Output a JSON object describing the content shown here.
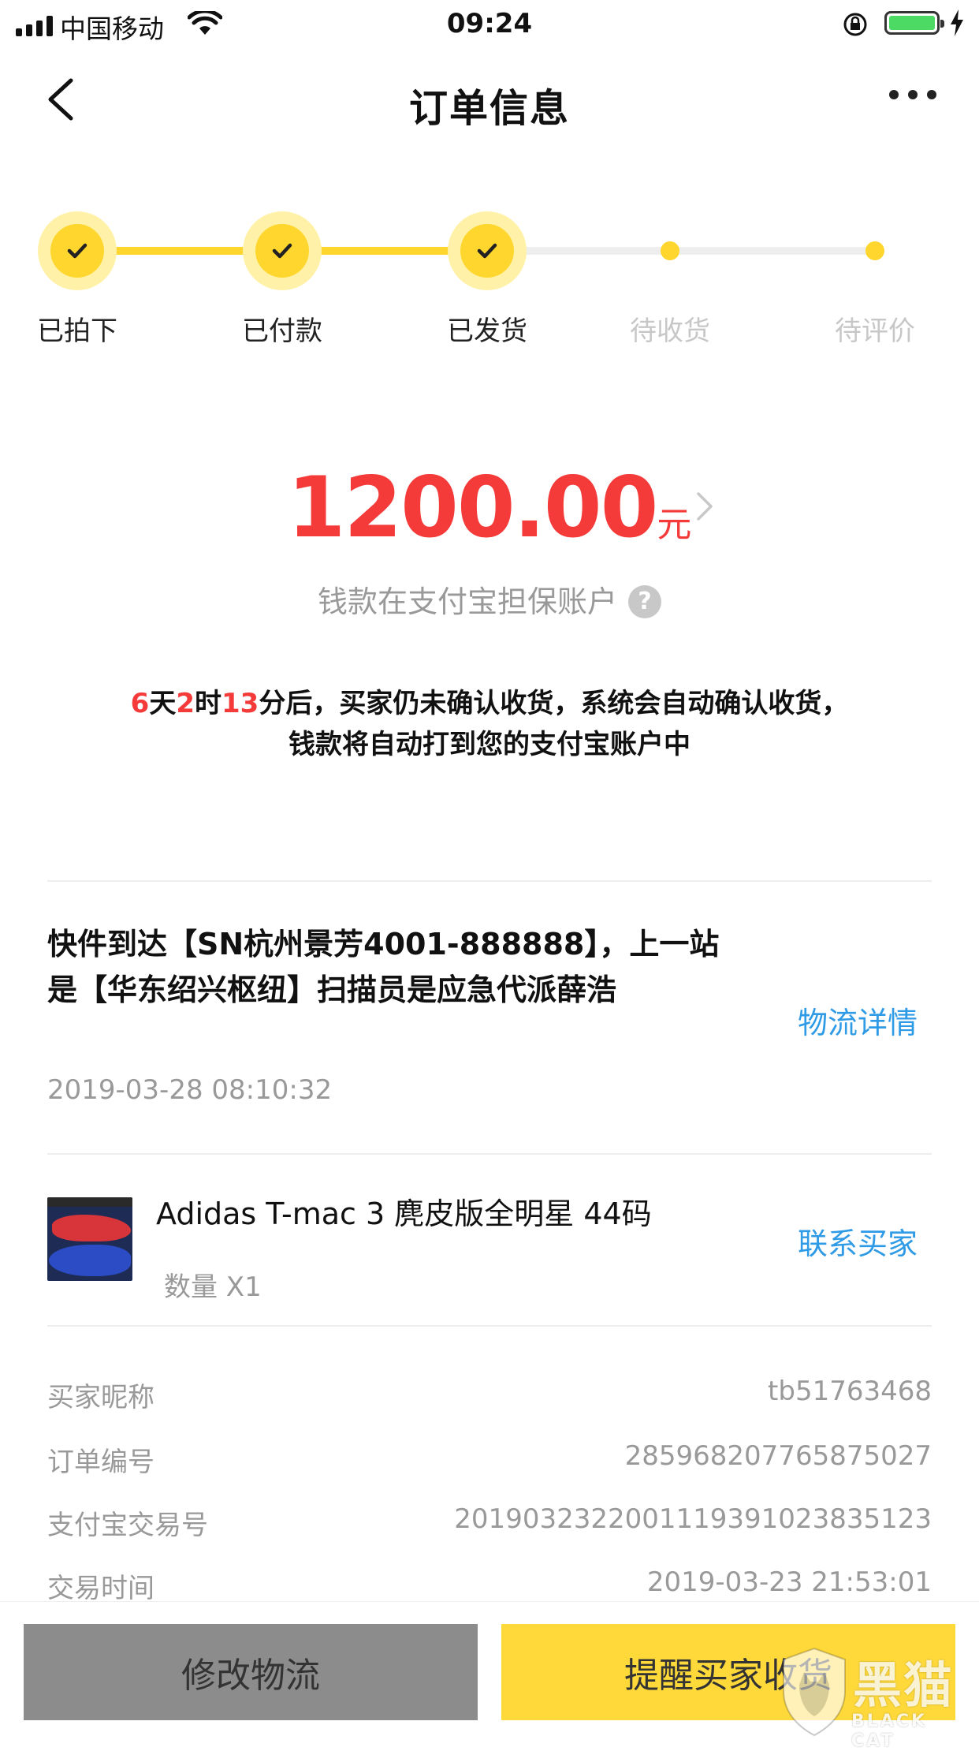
{
  "status_bar": {
    "carrier": "中国移动",
    "time": "09:24"
  },
  "nav": {
    "title": "订单信息"
  },
  "steps": [
    {
      "label": "已拍下",
      "state": "done"
    },
    {
      "label": "已付款",
      "state": "done"
    },
    {
      "label": "已发货",
      "state": "done"
    },
    {
      "label": "待收货",
      "state": "todo"
    },
    {
      "label": "待评价",
      "state": "todo"
    }
  ],
  "amount": {
    "value": "1200.00",
    "unit": "元",
    "escrow_note": "钱款在支付宝担保账户",
    "help_symbol": "?"
  },
  "countdown": {
    "days": "6",
    "days_unit": "天",
    "hours": "2",
    "hours_unit": "时",
    "minutes": "13",
    "line1_rest": "分后，买家仍未确认收货，系统会自动确认收货，",
    "line2": "钱款将自动打到您的支付宝账户中"
  },
  "logistics": {
    "text": "快件到达【SN杭州景芳4001-888888】，上一站是【华东绍兴枢纽】扫描员是应急代派薛浩",
    "time": "2019-03-28 08:10:32",
    "detail_link": "物流详情"
  },
  "product": {
    "name": "Adidas T-mac 3 麂皮版全明星 44码",
    "quantity": "数量 X1",
    "contact_link": "联系买家"
  },
  "order_info": [
    {
      "key": "买家昵称",
      "value": "tb51763468"
    },
    {
      "key": "订单编号",
      "value": "285968207765875027"
    },
    {
      "key": "支付宝交易号",
      "value": "2019032322001119391023835123"
    },
    {
      "key": "交易时间",
      "value": "2019-03-23 21:53:01"
    }
  ],
  "actions": {
    "left": "修改物流",
    "right": "提醒买家收货"
  },
  "watermark": {
    "text": "黑猫",
    "sub": "BLACK CAT"
  },
  "colors": {
    "accent_yellow": "#ffd62d",
    "price_red": "#f53a3a",
    "link_blue": "#2f9be6",
    "muted_gray": "#999999"
  }
}
